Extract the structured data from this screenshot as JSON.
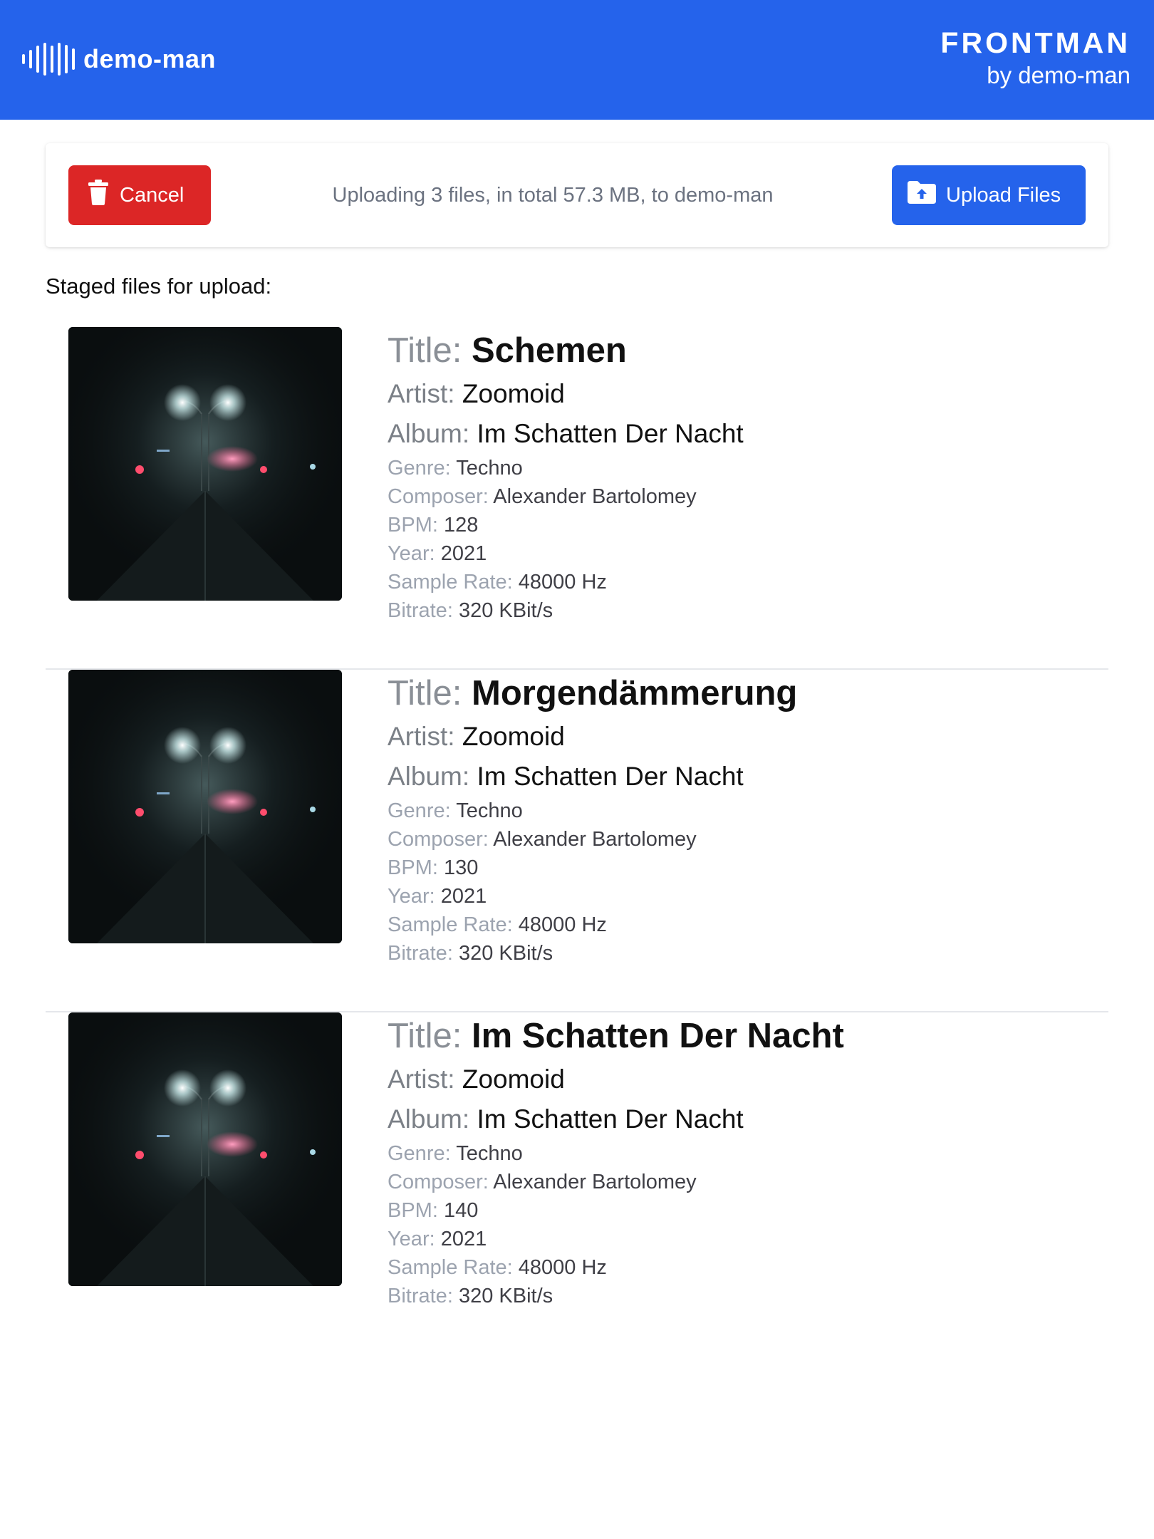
{
  "header": {
    "brand": "demo-man",
    "product": "FRONTMAN",
    "byline": "by demo-man",
    "background": "#2563eb"
  },
  "upload_bar": {
    "cancel_label": "Cancel",
    "summary": "Uploading 3 files, in total 57.3 MB, to demo-man",
    "upload_label": "Upload Files",
    "cancel_color": "#dc2626",
    "upload_color": "#2563eb"
  },
  "staged": {
    "heading": "Staged files for upload:"
  },
  "labels": {
    "title": "Title:",
    "artist": "Artist:",
    "album": "Album:",
    "genre": "Genre:",
    "composer": "Composer:",
    "bpm": "BPM:",
    "year": "Year:",
    "sample_rate": "Sample Rate:",
    "bitrate": "Bitrate:"
  },
  "tracks": [
    {
      "title": "Schemen",
      "artist": "Zoomoid",
      "album": "Im Schatten Der Nacht",
      "genre": "Techno",
      "composer": "Alexander Bartolomey",
      "bpm": "128",
      "year": "2021",
      "sample_rate": "48000 Hz",
      "bitrate": "320 KBit/s"
    },
    {
      "title": "Morgendämmerung",
      "artist": "Zoomoid",
      "album": "Im Schatten Der Nacht",
      "genre": "Techno",
      "composer": "Alexander Bartolomey",
      "bpm": "130",
      "year": "2021",
      "sample_rate": "48000 Hz",
      "bitrate": "320 KBit/s"
    },
    {
      "title": "Im Schatten Der Nacht",
      "artist": "Zoomoid",
      "album": "Im Schatten Der Nacht",
      "genre": "Techno",
      "composer": "Alexander Bartolomey",
      "bpm": "140",
      "year": "2021",
      "sample_rate": "48000 Hz",
      "bitrate": "320 KBit/s"
    }
  ]
}
